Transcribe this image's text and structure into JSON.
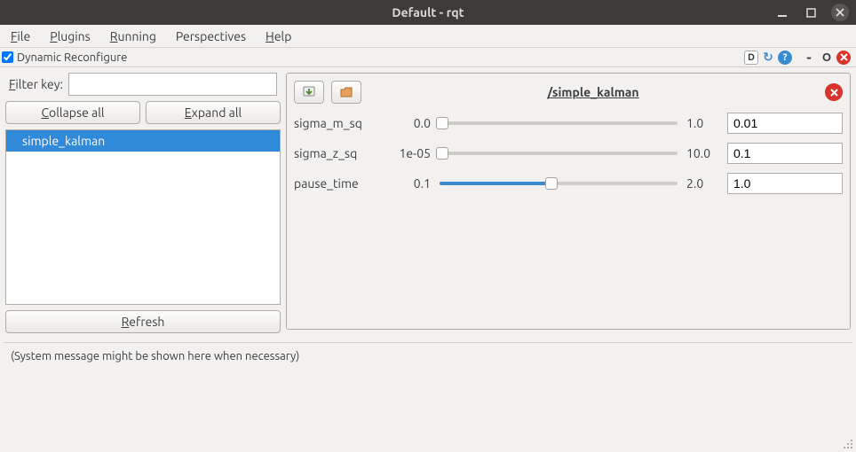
{
  "window": {
    "title": "Default - rqt"
  },
  "menu": {
    "file": "File",
    "plugins": "Plugins",
    "running": "Running",
    "perspectives": "Perspectives",
    "help": "Help"
  },
  "plugin": {
    "title": "Dynamic Reconfigure",
    "checked": true
  },
  "left": {
    "filter_label": "Filter key:",
    "filter_value": "",
    "collapse": "Collapse all",
    "expand": "Expand all",
    "refresh": "Refresh",
    "tree": [
      {
        "label": "simple_kalman",
        "selected": true
      }
    ]
  },
  "right": {
    "node_title": "/simple_kalman",
    "params": [
      {
        "name": "sigma_m_sq",
        "min": "0.0",
        "max": "1.0",
        "value": "0.01",
        "pct": 1
      },
      {
        "name": "sigma_z_sq",
        "min": "1e-05",
        "max": "10.0",
        "value": "0.1",
        "pct": 1
      },
      {
        "name": "pause_time",
        "min": "0.1",
        "max": "2.0",
        "value": "1.0",
        "pct": 47
      }
    ]
  },
  "status_message": "(System message might be shown here when necessary)"
}
